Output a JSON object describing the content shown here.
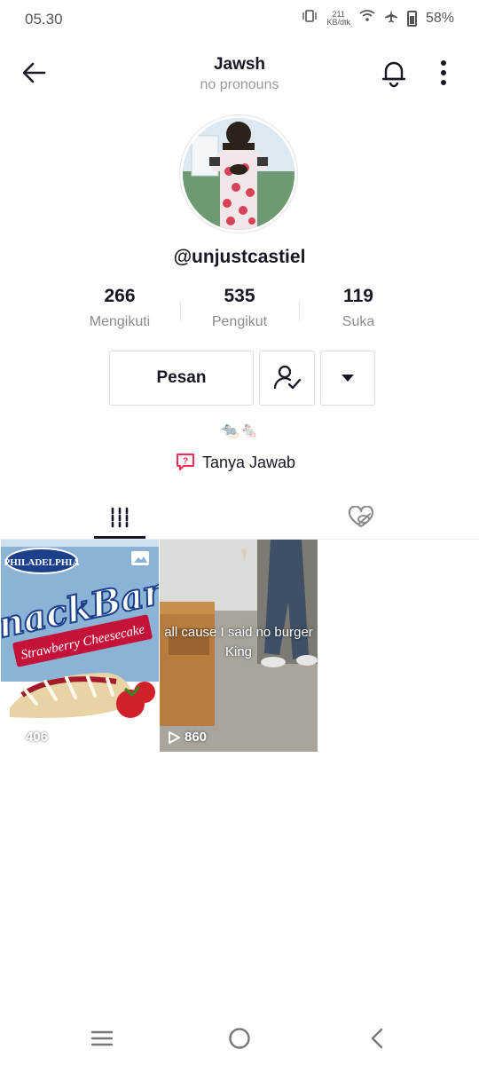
{
  "status": {
    "time": "05.30",
    "net_speed_value": "211",
    "net_speed_unit": "KB/dtk",
    "battery": "58%"
  },
  "header": {
    "name": "Jawsh",
    "pronouns": "no pronouns"
  },
  "profile": {
    "username": "@unjustcastiel",
    "bio": "🐀🐁"
  },
  "stats": [
    {
      "value": "266",
      "label": "Mengikuti"
    },
    {
      "value": "535",
      "label": "Pengikut"
    },
    {
      "value": "119",
      "label": "Suka"
    }
  ],
  "actions": {
    "message_label": "Pesan"
  },
  "qa": {
    "label": "Tanya Jawab"
  },
  "videos": [
    {
      "views": "406",
      "box_brand": "PHILADELPHIA",
      "box_title": "SnackBars",
      "box_sub": "Strawberry Cheesecake"
    },
    {
      "views": "860",
      "caption": "all cause I said no burger King"
    }
  ],
  "colors": {
    "accent_red": "#fe2c55",
    "text": "#161823",
    "secondary": "#8a8b91"
  }
}
